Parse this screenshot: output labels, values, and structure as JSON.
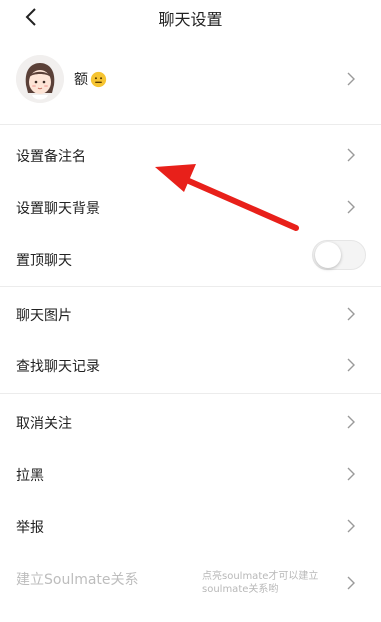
{
  "header": {
    "title": "聊天设置"
  },
  "profile": {
    "name": "额"
  },
  "rows": {
    "remark": "设置备注名",
    "background": "设置聊天背景",
    "pin": "置顶聊天",
    "images": "聊天图片",
    "search": "查找聊天记录",
    "unfollow": "取消关注",
    "block": "拉黑",
    "report": "举报",
    "soulmate": "建立Soulmate关系",
    "soulmate_hint": "点亮soulmate才可以建立soulmate关系哟"
  },
  "pin_toggle": {
    "enabled": false
  },
  "colors": {
    "arrow": "#e8201a",
    "disabled_text": "#bdbdbd",
    "divider": "#ececec"
  },
  "icons": [
    "back-arrow-icon",
    "chevron-right-icon",
    "neutral-face-emoji-icon"
  ]
}
